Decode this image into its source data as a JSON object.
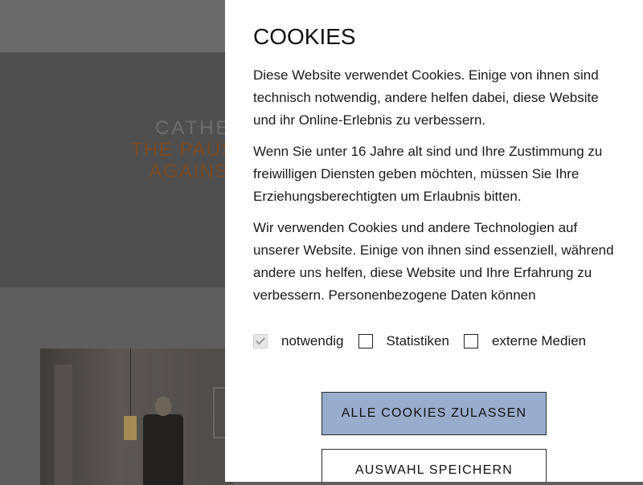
{
  "background": {
    "artist": "CATHERINE",
    "title_line1": "THE PAUSE THAT",
    "title_line2": "AGAINST ERA"
  },
  "cookie_banner": {
    "title": "COOKIES",
    "paragraphs": [
      "Diese Website verwendet Cookies. Einige von ihnen sind technisch notwendig, andere helfen dabei, diese Website und ihr Online-Erlebnis zu verbessern.",
      "Wenn Sie unter 16 Jahre alt sind und Ihre Zustimmung zu freiwilligen Diensten geben möchten, müssen Sie Ihre Erziehungsberechtigten um Erlaubnis bitten.",
      "Wir verwenden Cookies und andere Technologien auf unserer Website. Einige von ihnen sind essenziell, während andere uns helfen, diese Website und Ihre Erfahrung zu verbessern. Personenbezogene Daten können"
    ],
    "options": [
      {
        "label": "notwendig",
        "checked": true,
        "disabled": true
      },
      {
        "label": "Statistiken",
        "checked": false
      },
      {
        "label": "externe Medien",
        "checked": false
      }
    ],
    "accept_all_label": "ALLE COOKIES ZULASSEN",
    "save_selection_label": "AUSWAHL SPEICHERN"
  },
  "colors": {
    "accept_button_bg": "#9aaccd",
    "hero_title": "#7a4a22",
    "overlay_dim": "#5e5e5e"
  }
}
